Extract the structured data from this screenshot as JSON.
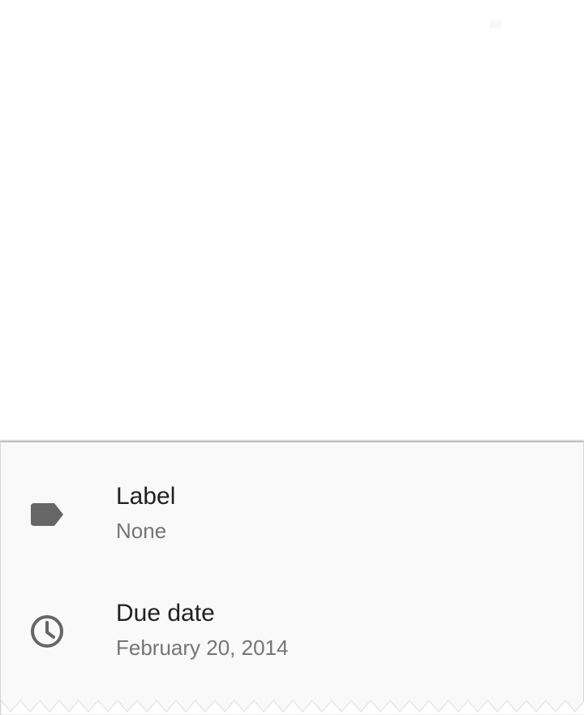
{
  "details": {
    "label": {
      "title": "Label",
      "value": "None",
      "icon": "label-tag-icon"
    },
    "due_date": {
      "title": "Due date",
      "value": "February 20, 2014",
      "icon": "clock-icon"
    }
  },
  "colors": {
    "panel_background": "#f9f9f9",
    "title_text": "#212121",
    "value_text": "#757575",
    "icon": "#666666"
  }
}
